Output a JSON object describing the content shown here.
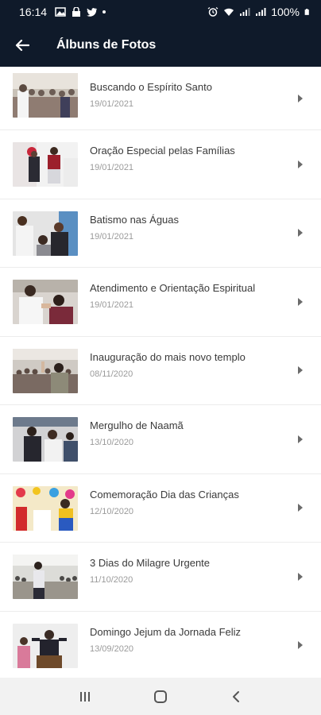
{
  "status_bar": {
    "time": "16:14",
    "battery": "100%",
    "icons_left": [
      "image-icon",
      "lock-icon",
      "twitter-icon",
      "dot-icon"
    ],
    "icons_right": [
      "alarm-icon",
      "wifi-icon",
      "signal-icon",
      "signal-icon",
      "battery-icon"
    ]
  },
  "app_bar": {
    "title": "Álbuns de Fotos",
    "back_icon": "arrow-left-icon",
    "color": "#0f1a2a"
  },
  "albums": [
    {
      "title": "Buscando o Espírito Santo",
      "date": "19/01/2021"
    },
    {
      "title": "Oração Especial pelas Famílias",
      "date": "19/01/2021"
    },
    {
      "title": "Batismo nas Águas",
      "date": "19/01/2021"
    },
    {
      "title": "Atendimento e Orientação Espiritual",
      "date": "19/01/2021"
    },
    {
      "title": " Inauguração do mais novo templo",
      "date": "08/11/2020"
    },
    {
      "title": "Mergulho de Naamã",
      "date": "13/10/2020"
    },
    {
      "title": "Comemoração Dia das Crianças",
      "date": "12/10/2020"
    },
    {
      "title": "3 Dias do Milagre Urgente",
      "date": "11/10/2020"
    },
    {
      "title": "Domingo Jejum da Jornada Feliz",
      "date": "13/09/2020"
    }
  ],
  "nav_bar": {
    "buttons": [
      "recent-apps-icon",
      "home-icon",
      "back-icon"
    ]
  }
}
